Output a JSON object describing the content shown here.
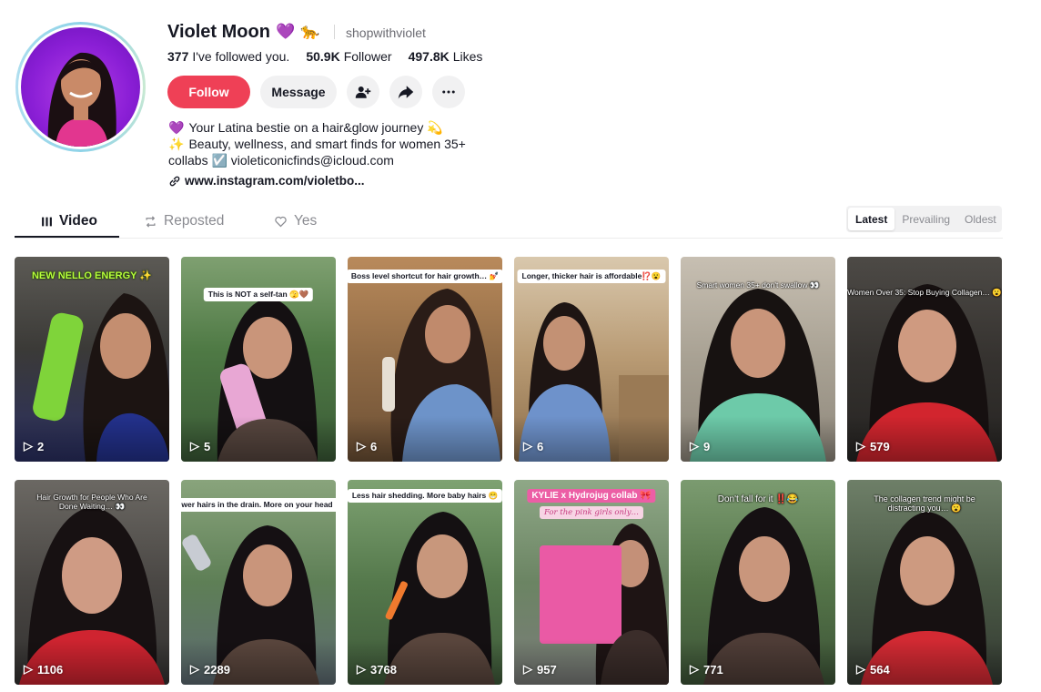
{
  "profile": {
    "name": "Violet Moon",
    "badges": [
      "💜",
      "🐆"
    ],
    "username": "shopwithviolet",
    "stats": [
      {
        "value": "377",
        "label": "I've followed you."
      },
      {
        "value": "50.9K",
        "label": "Follower"
      },
      {
        "value": "497.8K",
        "label": "Likes"
      }
    ]
  },
  "actions": {
    "follow_label": "Follow",
    "message_label": "Message",
    "add_friend_icon": "add-user-icon",
    "share_icon": "share-icon",
    "more_icon": "more-icon"
  },
  "bio": {
    "lines": [
      {
        "emoji": "💜",
        "text": "Your Latina bestie on a hair&glow journey 💫"
      },
      {
        "emoji": "✨",
        "text": "Beauty, wellness, and smart finds for women 35+"
      },
      {
        "emoji": "",
        "text": "collabs ☑️ violeticonicfinds@icloud.com"
      }
    ],
    "link": "www.instagram.com/violetbo..."
  },
  "tabs": [
    {
      "label": "Video",
      "icon": "grid-icon",
      "active": true
    },
    {
      "label": "Reposted",
      "icon": "repost-icon",
      "active": false
    },
    {
      "label": "Yes",
      "icon": "heart-icon",
      "active": false
    }
  ],
  "sort": [
    {
      "label": "Latest",
      "active": true
    },
    {
      "label": "Prevailing",
      "active": false
    },
    {
      "label": "Oldest",
      "active": false
    }
  ],
  "videos": [
    {
      "caption": "NEW NELLO ENERGY ✨",
      "views": "2"
    },
    {
      "caption": "This is NOT a self-tan 🫣🤎",
      "views": "5"
    },
    {
      "caption": "Boss level shortcut for hair growth… 💅",
      "views": "6"
    },
    {
      "caption": "Longer, thicker hair is affordable⁉️😮",
      "views": "6"
    },
    {
      "caption": "Smart women 35+ don't swallow 👀",
      "views": "9"
    },
    {
      "caption": "Women Over 35: Stop Buying Collagen… 😮",
      "views": "579"
    },
    {
      "caption": "Hair Growth for People Who Are Done Waiting… 👀",
      "views": "1106"
    },
    {
      "caption": "Fewer hairs in the drain. More on your head ‼️",
      "views": "2289"
    },
    {
      "caption": "Less hair shedding. More baby hairs 😁",
      "views": "3768"
    },
    {
      "caption": "KYLIE x Hydrojug collab 🎀",
      "subcaption": "For the pink girls only…",
      "views": "957"
    },
    {
      "caption": "Don't fall for it ‼️😂",
      "views": "771"
    },
    {
      "caption": "The collagen trend might be distracting you… 😮",
      "views": "564"
    }
  ],
  "colors": {
    "follow": "#ef4056",
    "text": "#161823",
    "muted": "#8a8b91",
    "avatar_bg": "#8b1fd6"
  }
}
